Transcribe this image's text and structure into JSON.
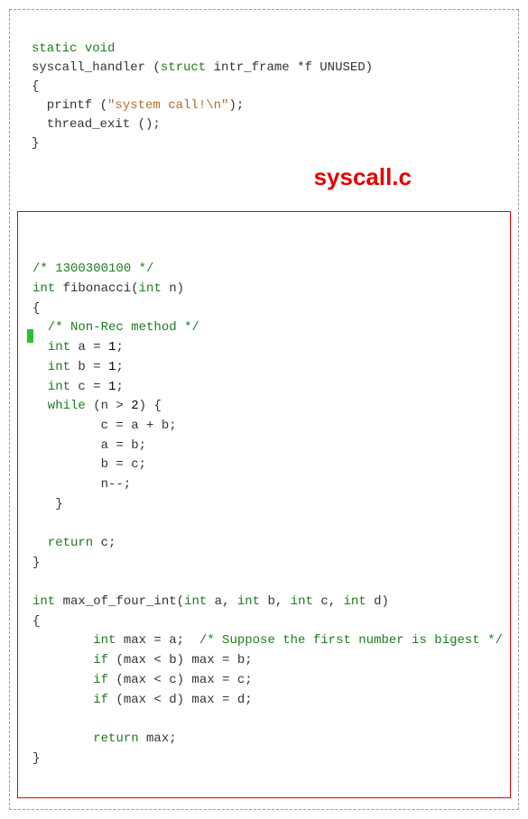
{
  "title": "syscall.c",
  "top": {
    "l1a": "static",
    "l1b": "void",
    "l2a": "syscall_handler (",
    "l2b": "struct",
    "l2c": " intr_frame *f UNUSED)",
    "l3": "{",
    "l4a": "  printf (",
    "l4b": "\"system call!\\n\"",
    "l4c": ");",
    "l5": "  thread_exit ();",
    "l6": "}"
  },
  "fib": {
    "c1": "/* 1300300100 */",
    "l1a": "int",
    "l1b": " fibonacci(",
    "l1c": "int",
    "l1d": " n)",
    "l2": "{",
    "c2": "  /* Non-Rec method */",
    "l3a": "  int",
    "l3b": " a = ",
    "l3c": "1",
    "l3d": ";",
    "l4a": "  int",
    "l4b": " b = ",
    "l4c": "1",
    "l4d": ";",
    "l5a": "  int",
    "l5b": " c = ",
    "l5c": "1",
    "l5d": ";",
    "l6a": "  while",
    "l6b": " (n > ",
    "l6c": "2",
    "l6d": ") {",
    "l7": "         c = a + b;",
    "l8": "         a = b;",
    "l9": "         b = c;",
    "l10": "         n--;",
    "l11": "   }",
    "blank": "",
    "l12a": "  return",
    "l12b": " c;",
    "l13": "}"
  },
  "max": {
    "l1a": "int",
    "l1b": " max_of_four_int(",
    "l1c": "int",
    "l1d": " a, ",
    "l1e": "int",
    "l1f": " b, ",
    "l1g": "int",
    "l1h": " c, ",
    "l1i": "int",
    "l1j": " d)",
    "l2": "{",
    "l3a": "        int",
    "l3b": " max = a;  ",
    "l3c": "/* Suppose the first number is bigest */",
    "l4a": "        if",
    "l4b": " (max < b) max = b;",
    "l5a": "        if",
    "l5b": " (max < c) max = c;",
    "l6a": "        if",
    "l6b": " (max < d) max = d;",
    "blank": "",
    "l7a": "        return",
    "l7b": " max;",
    "l8": "}"
  }
}
